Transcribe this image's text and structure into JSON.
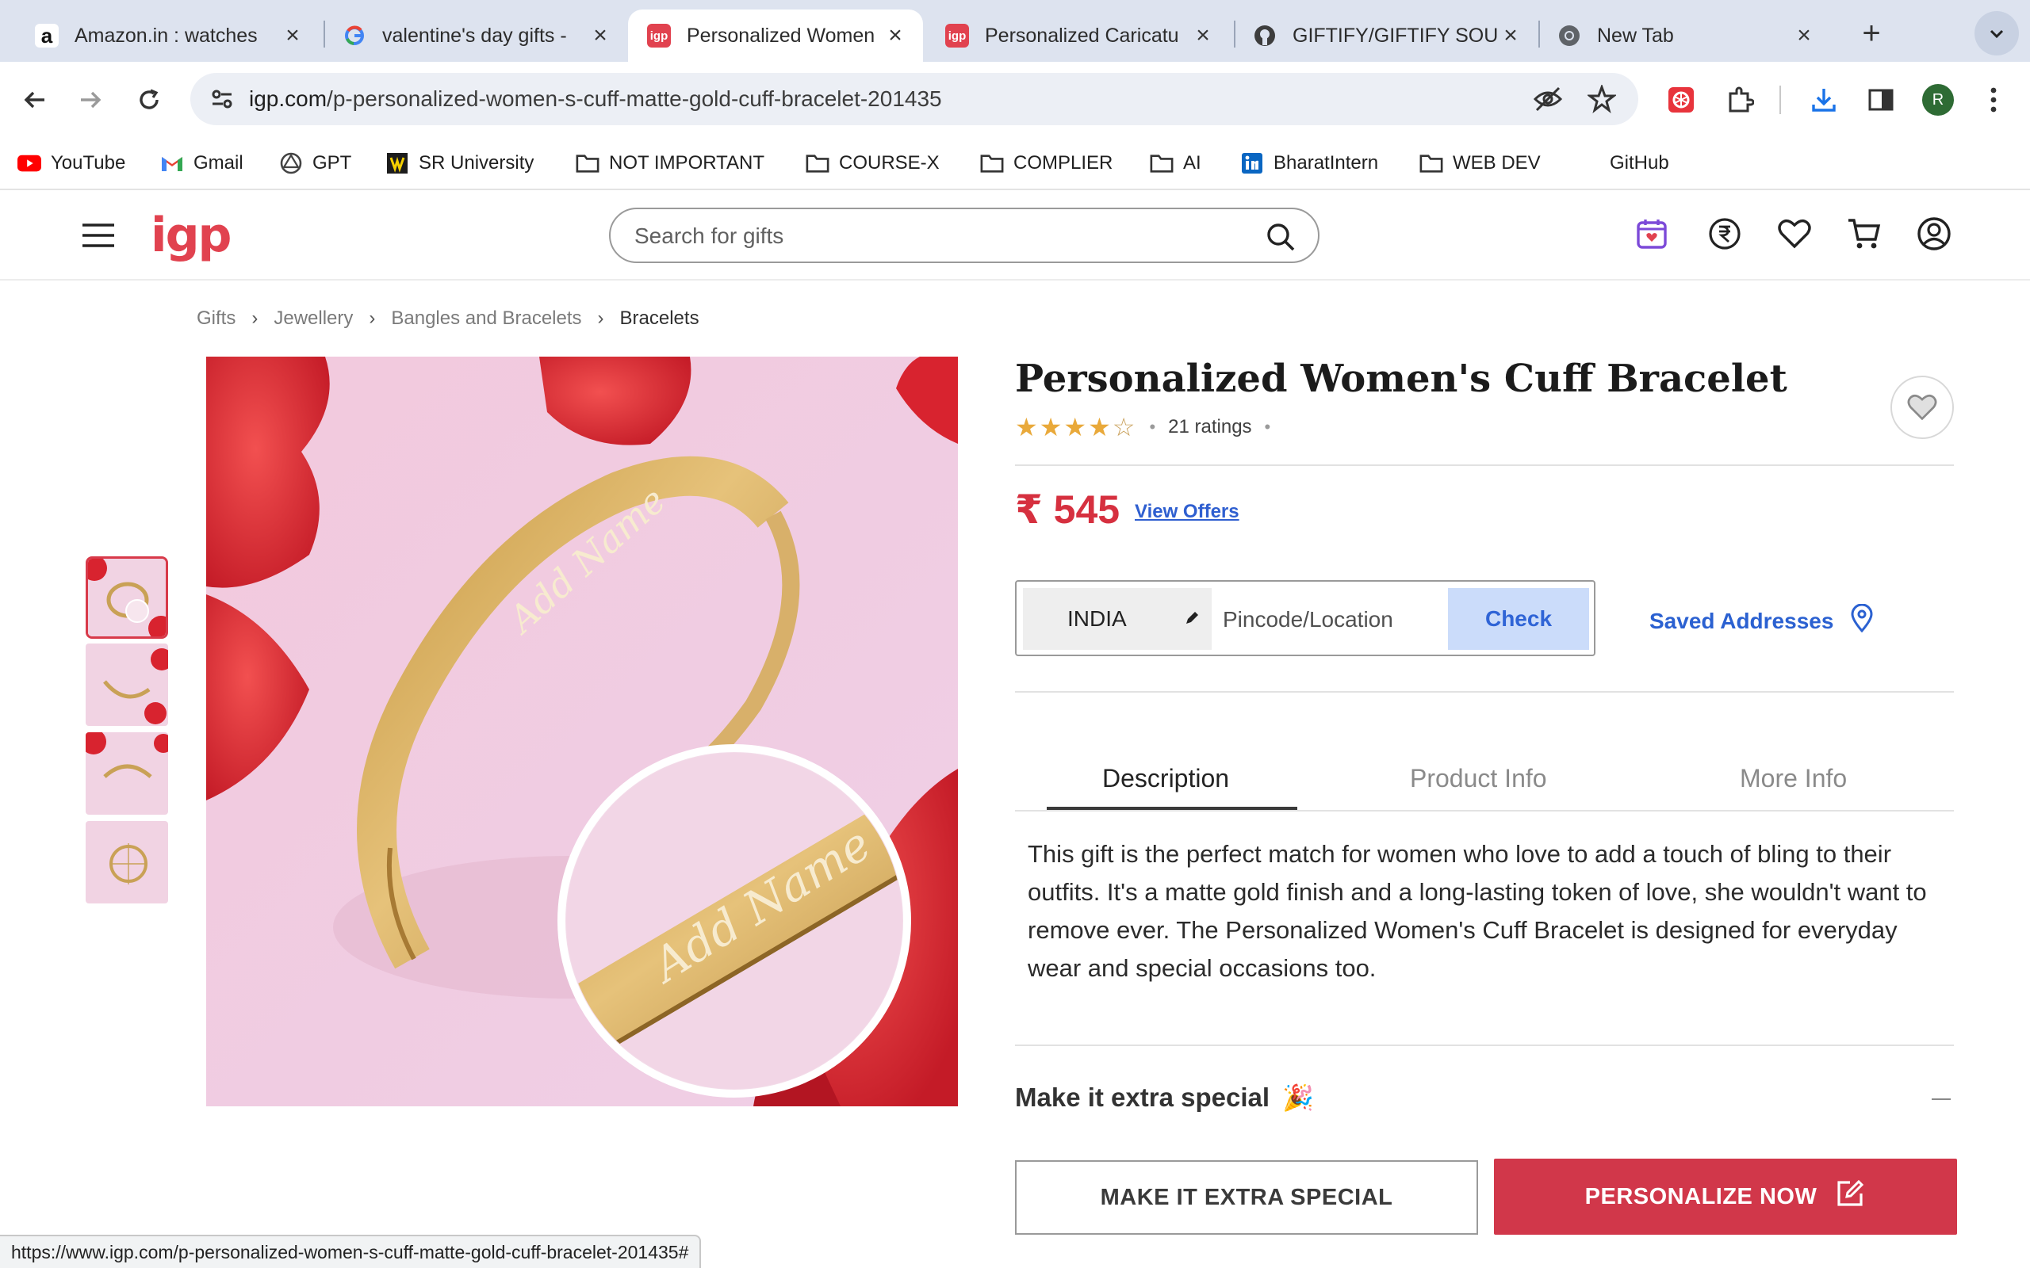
{
  "browser": {
    "tabs": [
      {
        "title": "Amazon.in : watches",
        "favicon": "amazon-favicon"
      },
      {
        "title": "valentine's day gifts -",
        "favicon": "google-favicon"
      },
      {
        "title": "Personalized Women",
        "favicon": "igp-favicon",
        "active": true
      },
      {
        "title": "Personalized Caricatu",
        "favicon": "igp-favicon"
      },
      {
        "title": "GIFTIFY/GIFTIFY SOU",
        "favicon": "github-favicon"
      },
      {
        "title": "New Tab",
        "favicon": "chrome-favicon"
      }
    ],
    "favicon_text": {
      "amazon": "a",
      "igp": "igp"
    },
    "url_host": "igp.com",
    "url_path": "/p-personalized-women-s-cuff-matte-gold-cuff-bracelet-201435",
    "profile_initial": "R",
    "bookmarks": [
      {
        "label": "YouTube",
        "icon": "youtube-icon"
      },
      {
        "label": "Gmail",
        "icon": "gmail-icon"
      },
      {
        "label": "GPT",
        "icon": "openai-icon"
      },
      {
        "label": "SR University",
        "icon": "sr-university-icon"
      },
      {
        "label": "NOT IMPORTANT",
        "icon": "folder-icon"
      },
      {
        "label": "COURSE-X",
        "icon": "folder-icon"
      },
      {
        "label": "COMPLIER",
        "icon": "folder-icon"
      },
      {
        "label": "AI",
        "icon": "folder-icon"
      },
      {
        "label": "BharatIntern",
        "icon": "linkedin-icon"
      },
      {
        "label": "WEB DEV",
        "icon": "folder-icon"
      },
      {
        "label": "GitHub",
        "icon": "none"
      }
    ],
    "status_url": "https://www.igp.com/p-personalized-women-s-cuff-matte-gold-cuff-bracelet-201435#"
  },
  "site": {
    "logo": "igp",
    "search_placeholder": "Search for gifts",
    "brand_color": "#e1424f"
  },
  "breadcrumb": [
    "Gifts",
    "Jewellery",
    "Bangles and Bracelets",
    "Bracelets"
  ],
  "gallery": {
    "thumbnail_count": 4,
    "selected_index": 0,
    "engraving_text": "Add Name"
  },
  "product": {
    "title": "Personalized Women's Cuff Bracelet",
    "rating": 4,
    "rating_max": 5,
    "ratings_text": "21 ratings",
    "price": "₹ 545",
    "view_offers": "View Offers",
    "price_color": "#d6303f"
  },
  "delivery": {
    "country": "INDIA",
    "pincode_placeholder": "Pincode/Location",
    "check_label": "Check",
    "saved_addresses": "Saved Addresses"
  },
  "details_tabs": {
    "items": [
      "Description",
      "Product Info",
      "More Info"
    ],
    "active": 0
  },
  "description": "This gift is the perfect match for women who love to add a touch of bling to their outfits. It's a matte gold finish and a long-lasting token of love, she wouldn't want to remove ever. The Personalized Women's Cuff Bracelet is designed for everyday wear and special occasions too.",
  "extra_special": {
    "heading": "Make it extra special",
    "emoji": "🎉"
  },
  "actions": {
    "make_extra_special": "MAKE IT EXTRA SPECIAL",
    "personalize_now": "PERSONALIZE NOW",
    "primary_color": "#d1374a"
  }
}
